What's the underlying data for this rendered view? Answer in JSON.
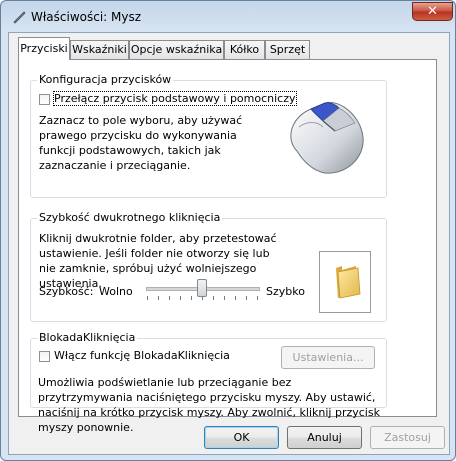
{
  "window": {
    "title": "Właściwości: Mysz",
    "close_glyph": "✕"
  },
  "tabs": [
    {
      "label": "Przyciski",
      "active": true
    },
    {
      "label": "Wskaźniki",
      "active": false
    },
    {
      "label": "Opcje wskaźnika",
      "active": false
    },
    {
      "label": "Kółko",
      "active": false
    },
    {
      "label": "Sprzęt",
      "active": false
    }
  ],
  "button_config": {
    "legend": "Konfiguracja przycisków",
    "checkbox_label": "Przełącz przycisk podstawowy i pomocniczy",
    "checked": false,
    "description": "Zaznacz to pole wyboru, aby używać prawego przycisku do wykonywania funkcji podstawowych, takich jak zaznaczanie i przeciąganie."
  },
  "double_click": {
    "legend": "Szybkość dwukrotnego kliknięcia",
    "description": "Kliknij dwukrotnie folder, aby przetestować ustawienie. Jeśli folder nie otworzy się lub nie zamknie, spróbuj użyć wolniejszego ustawienia.",
    "speed_label": "Szybkość:",
    "slow_label": "Wolno",
    "fast_label": "Szybko",
    "slider_value_fraction": 0.5
  },
  "clicklock": {
    "legend": "BlokadaKliknięcia",
    "checkbox_label": "Włącz funkcję BlokadaKliknięcia",
    "checked": false,
    "settings_button": "Ustawienia...",
    "description": "Umożliwia podświetlanie lub przeciąganie bez przytrzymywania naciśniętego przycisku myszy. Aby ustawić, naciśnij na krótko przycisk myszy. Aby zwolnić, kliknij przycisk myszy ponownie."
  },
  "footer": {
    "ok": "OK",
    "cancel": "Anuluj",
    "apply": "Zastosuj"
  },
  "icons": {
    "title_icon": "mouse-pointer-icon",
    "mouse_image": "mouse-icon",
    "folder_image": "folder-icon"
  }
}
